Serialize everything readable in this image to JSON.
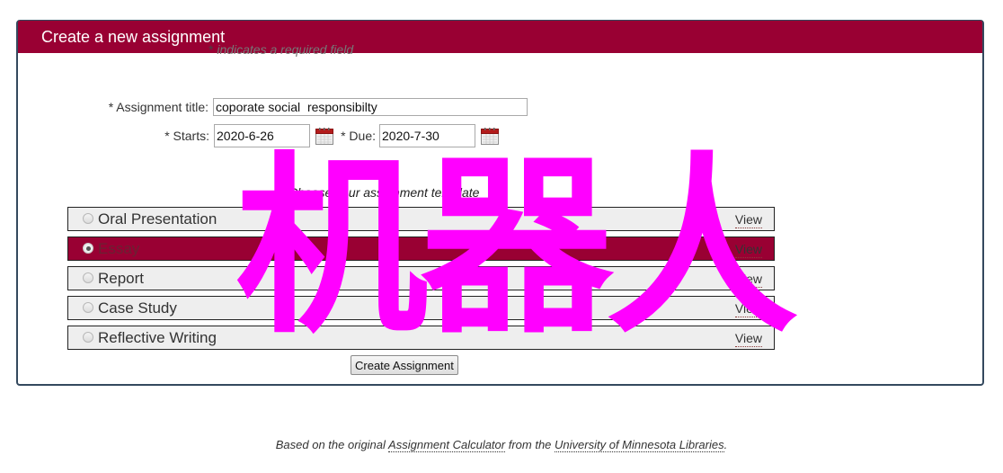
{
  "panel": {
    "title": "Create a new assignment",
    "required_note_star": "*",
    "required_note_text": " indicates a required field"
  },
  "form": {
    "title_label": "* Assignment title:",
    "title_value": "coporate social  responsibilty",
    "starts_label": "* Starts:",
    "starts_value": "2020-6-26",
    "due_label": "* Due:",
    "due_value": "2020-7-30",
    "calendar_icon": "calendar-icon"
  },
  "templates": {
    "instruction": "Choose your assignment template",
    "view_label": "View",
    "items": [
      {
        "label": "Oral Presentation",
        "selected": false
      },
      {
        "label": "Essay",
        "selected": true
      },
      {
        "label": "Report",
        "selected": false
      },
      {
        "label": "Case Study",
        "selected": false
      },
      {
        "label": "Reflective Writing",
        "selected": false
      }
    ]
  },
  "create_button": "Create Assignment",
  "footer": {
    "prefix": "Based on the original ",
    "link1": "Assignment Calculator",
    "middle": " from the ",
    "link2": "University of Minnesota Libraries",
    "suffix": "."
  },
  "overlay": {
    "watermark_text": "机器人"
  },
  "colors": {
    "header": "#990033",
    "border": "#34495e",
    "selected_row": "#990033",
    "watermark": "#ff00ff"
  }
}
